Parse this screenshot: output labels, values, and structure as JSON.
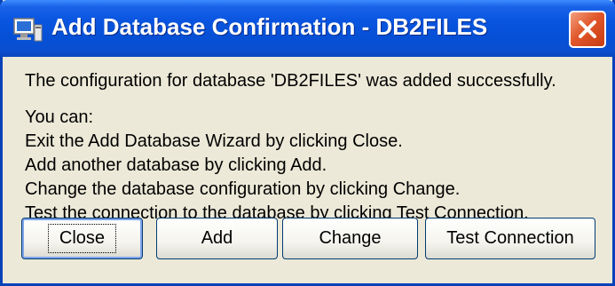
{
  "window": {
    "title": "Add Database Confirmation - DB2FILES",
    "icon": "database-window-icon",
    "close_icon": "close-icon"
  },
  "message": {
    "summary": "The configuration for database 'DB2FILES' was added successfully.",
    "intro": "You can:",
    "options": [
      "Exit the Add Database Wizard by clicking Close.",
      "Add another database by clicking Add.",
      "Change the database configuration by clicking Change.",
      "Test the connection to the database by clicking Test Connection."
    ]
  },
  "buttons": {
    "close": "Close",
    "add": "Add",
    "change": "Change",
    "test_connection": "Test Connection"
  },
  "colors": {
    "titlebar": "#0650d6",
    "window_background": "#ece9d8",
    "close_button": "#e1572b",
    "border": "#0842b9"
  }
}
